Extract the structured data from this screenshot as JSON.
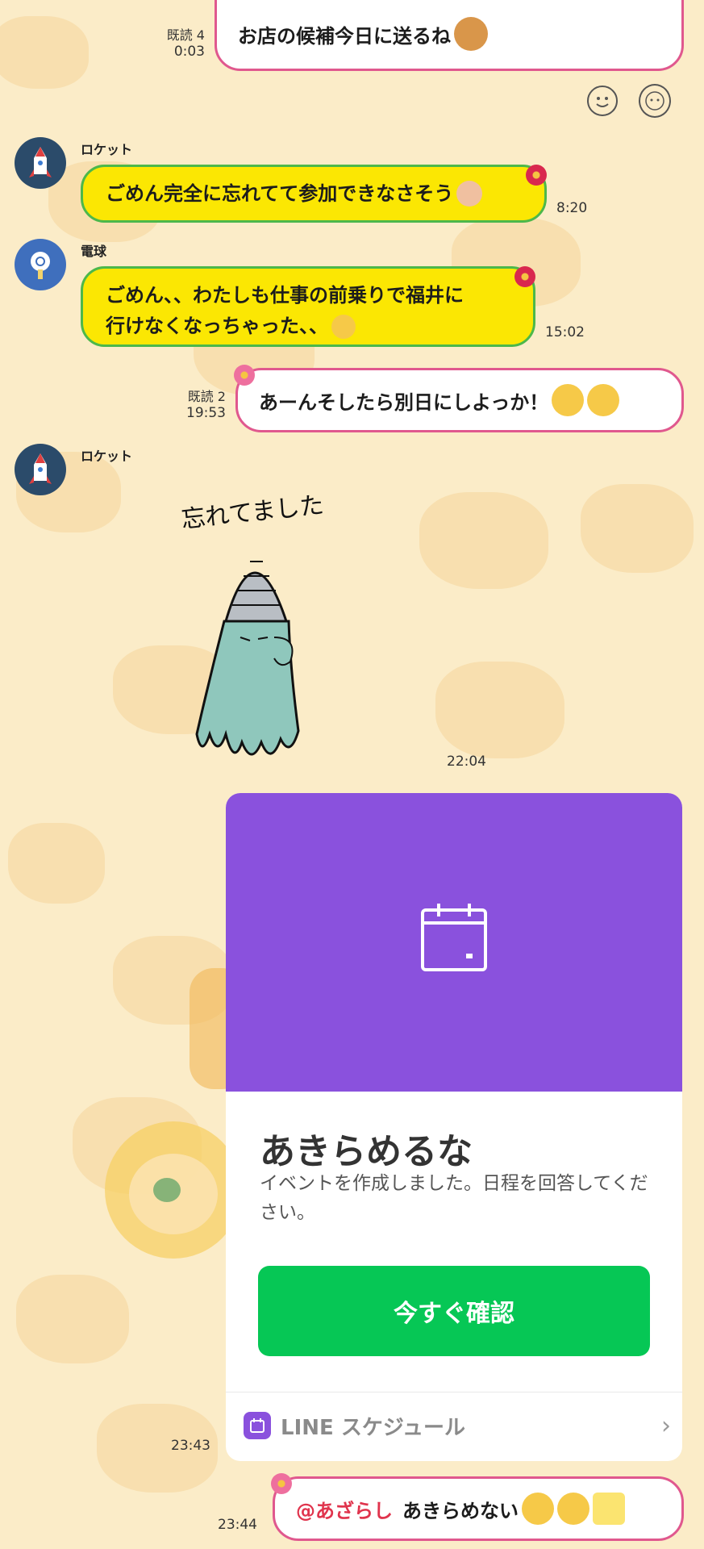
{
  "messages": {
    "m1": {
      "read": "既読 4",
      "time": "0:03",
      "text": "お店の候補今日に送るね"
    },
    "m2": {
      "sender": "ロケット",
      "text": "ごめん完全に忘れてて参加できなさそう",
      "time": "8:20"
    },
    "m3": {
      "sender": "電球",
      "line1": "ごめん、、わたしも仕事の前乗りで福井に",
      "line2": "行けなくなっちゃった、、",
      "time": "15:02"
    },
    "m4": {
      "read": "既読 2",
      "time": "19:53",
      "text": "あーんそしたら別日にしよっか！"
    },
    "m5": {
      "sender": "ロケット",
      "sticker_text": "忘れてました",
      "time": "22:04"
    },
    "m6": {
      "time": "23:43"
    },
    "m7": {
      "time": "23:44",
      "mention": "@あざらし",
      "text": "あきらめない"
    }
  },
  "event_card": {
    "title": "あきらめるな",
    "description": "イベントを作成しました。日程を回答してください。",
    "button": "今すぐ確認",
    "footer": "LINE スケジュール",
    "accent": "#8a51dd",
    "button_color": "#06c755"
  },
  "colors": {
    "background": "#fbecc8",
    "incoming_bubble": "#fbe703",
    "incoming_border": "#4cb84a",
    "outgoing_border": "#e0588e"
  },
  "icons": [
    "smile-icon",
    "bear-sticker-icon",
    "rocket-avatar-icon",
    "bulb-avatar-icon",
    "calendar-icon",
    "chevron-right-icon"
  ]
}
